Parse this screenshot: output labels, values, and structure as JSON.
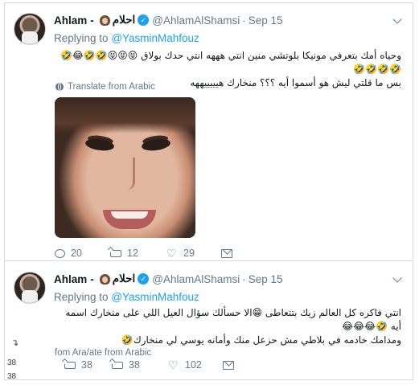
{
  "tweets": [
    {
      "name": "Ahlam",
      "name_sep": "-",
      "name_arabic": "احلام",
      "handle": "@AhlamAlShamsi",
      "dot": "·",
      "date": "Sep 15",
      "replying_prefix": "Replying to",
      "replying_to": "@YasminMahfouz",
      "text_lines": [
        "وحياه أمك بتعرفي مونيكا بلوتشي منين انتي هههه انتي حدك بولاق 😝😝😝🤣🤣😂🤣🤣🤣🤣🤣",
        "بس ما قلتي ليش هو أسموا أيه ؟؟؟ منخارك هيييييههه"
      ],
      "translate_label": "Translate from Arabic",
      "replies": "20",
      "retweets": "12",
      "likes": "29"
    },
    {
      "name": "Ahlam",
      "name_sep": "-",
      "name_arabic": "احلام",
      "handle": "@AhlamAlShamsi",
      "dot": "·",
      "date": "Sep 15",
      "replying_prefix": "Replying to",
      "replying_to": "@YasminMahfouz",
      "text_lines": [
        "انتي فاكره كل العالم زيك بتتعاطى 😁الا حسألك سؤال العيل اللي على منخارك اسمه أيه 🤣😂😂😂",
        "ومدامك خادمه في بلاطي مش حزعل منك وأمانه يوسي لي منخارك🤣"
      ],
      "translate_label": "fom Ara/ate from Arabic",
      "replies": "38",
      "retweets": "38",
      "likes": "102"
    }
  ],
  "side_marks": {
    "arrow": "↴",
    "num_1": "38",
    "num_2": "38"
  }
}
